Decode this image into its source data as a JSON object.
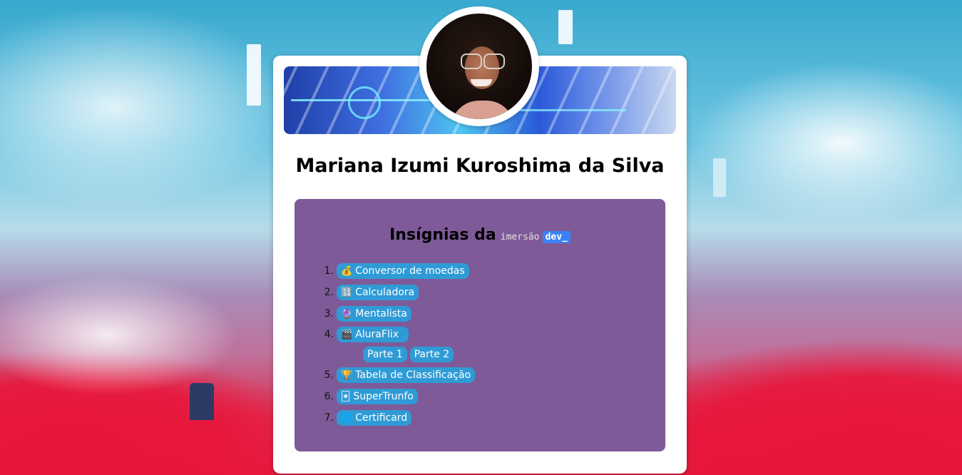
{
  "profile": {
    "name": "Mariana Izumi Kuroshima da Silva"
  },
  "badges_panel": {
    "title": "Insígnias da",
    "brand_imersao": "imersão",
    "brand_dev": "dev_",
    "items": [
      {
        "number": "1.",
        "icon": "money-bag-icon",
        "glyph": "💰",
        "label": "Conversor de moedas"
      },
      {
        "number": "2.",
        "icon": "calculator-icon",
        "glyph": "🔢",
        "label": "Calculadora"
      },
      {
        "number": "3.",
        "icon": "crystal-ball-icon",
        "glyph": "🔮",
        "label": "Mentalista"
      },
      {
        "number": "4.",
        "icon": "clapperboard-icon",
        "glyph": "🎬",
        "label": "AluraFlix",
        "parts": [
          "Parte 1",
          "Parte 2"
        ]
      },
      {
        "number": "5.",
        "icon": "trophy-icon",
        "glyph": "🏆",
        "label": "Tabela de Classificação"
      },
      {
        "number": "6.",
        "icon": "playing-card-icon",
        "glyph": "🃏",
        "label": "SuperTrunfo"
      },
      {
        "number": "7.",
        "icon": "globe-icon",
        "glyph": "🌐",
        "label": "Certificard"
      }
    ]
  },
  "colors": {
    "panel": "#7f5a99",
    "pill": "#2f9bd6",
    "dev_badge": "#3b82f6"
  }
}
